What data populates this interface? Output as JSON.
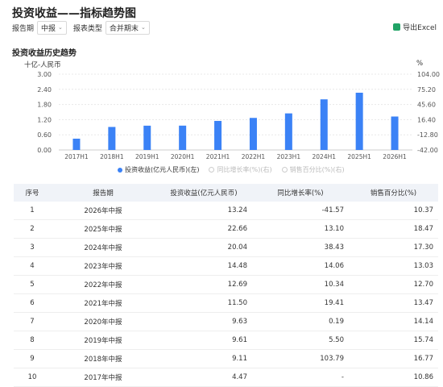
{
  "page": {
    "title": "投资收益——指标趋势图",
    "filters": [
      {
        "label": "报告期",
        "value": "中报"
      },
      {
        "label": "报表类型",
        "value": "合并期末"
      }
    ],
    "export_label": "导出Excel",
    "section_title": "投资收益历史趋势"
  },
  "chart_data": {
    "type": "bar",
    "left_unit": "十亿-人民币",
    "right_unit": "%",
    "categories": [
      "2017H1",
      "2018H1",
      "2019H1",
      "2020H1",
      "2021H1",
      "2022H1",
      "2023H1",
      "2024H1",
      "2025H1",
      "2026H1"
    ],
    "series": [
      {
        "name": "投资收益(亿元人民币)(左)",
        "values": [
          0.447,
          0.911,
          0.961,
          0.963,
          1.15,
          1.269,
          1.448,
          2.004,
          2.266,
          1.324
        ],
        "color": "#3b82f6",
        "active": true
      },
      {
        "name": "同比增长率(%)(右)",
        "active": false
      },
      {
        "name": "销售百分比(%)(右)",
        "active": false
      }
    ],
    "y_left_ticks": [
      "3.00",
      "2.40",
      "1.80",
      "1.20",
      "0.60",
      "0.00"
    ],
    "y_right_ticks": [
      "104.00",
      "75.20",
      "45.60",
      "16.40",
      "-12.80",
      "-42.00"
    ],
    "ylim": [
      0,
      3.0
    ],
    "grid": true
  },
  "table": {
    "headers": [
      "序号",
      "报告期",
      "投资收益(亿元人民币)",
      "同比增长率(%)",
      "销售百分比(%)"
    ],
    "rows": [
      [
        "1",
        "2026年中报",
        "13.24",
        "-41.57",
        "10.37"
      ],
      [
        "2",
        "2025年中报",
        "22.66",
        "13.10",
        "18.47"
      ],
      [
        "3",
        "2024年中报",
        "20.04",
        "38.43",
        "17.30"
      ],
      [
        "4",
        "2023年中报",
        "14.48",
        "14.06",
        "13.03"
      ],
      [
        "5",
        "2022年中报",
        "12.69",
        "10.34",
        "12.70"
      ],
      [
        "6",
        "2021年中报",
        "11.50",
        "19.41",
        "13.47"
      ],
      [
        "7",
        "2020年中报",
        "9.63",
        "0.19",
        "14.14"
      ],
      [
        "8",
        "2019年中报",
        "9.61",
        "5.50",
        "15.74"
      ],
      [
        "9",
        "2018年中报",
        "9.11",
        "103.79",
        "16.77"
      ],
      [
        "10",
        "2017年中报",
        "4.47",
        "-",
        "10.86"
      ]
    ]
  }
}
